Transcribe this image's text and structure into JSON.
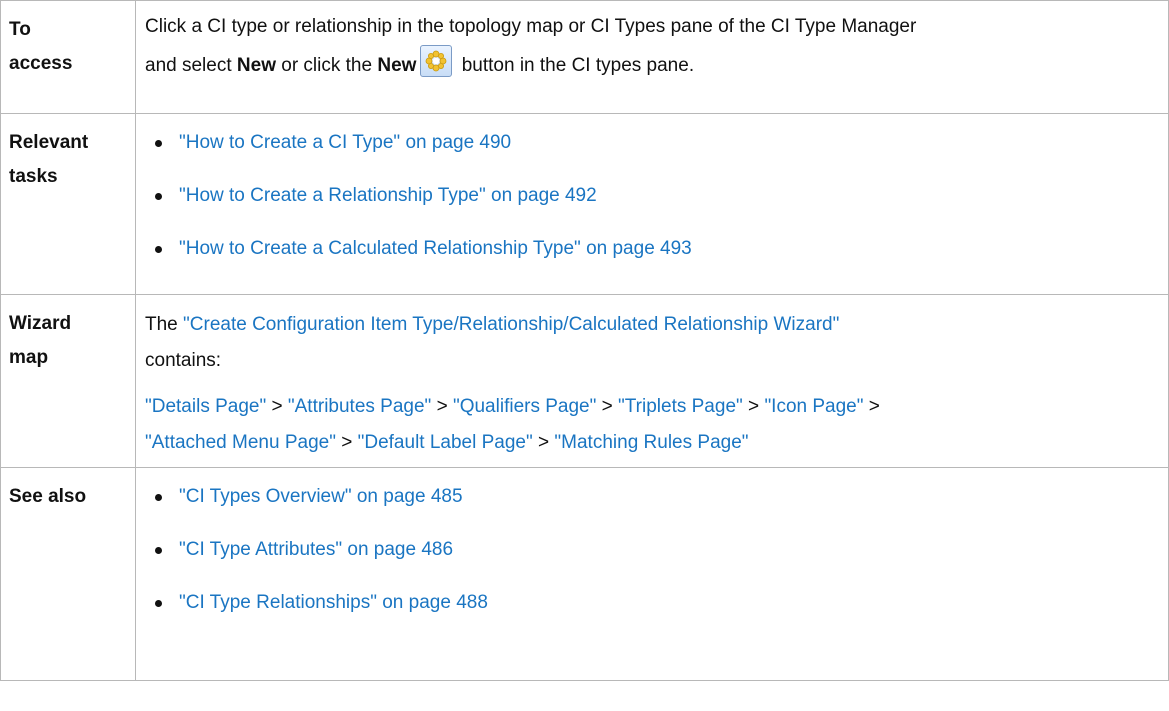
{
  "rows": {
    "access": {
      "label_line1": "To",
      "label_line2": "access",
      "text1": "Click a CI type or relationship in the topology map or CI Types pane of the CI Type Manager",
      "text2": "and select ",
      "bold_new1": "New",
      "text3": " or click the ",
      "bold_new2": "New",
      "text4": " button in the CI types pane.",
      "icon": "new-icon"
    },
    "tasks": {
      "label_line1": "Relevant",
      "label_line2": "tasks",
      "items": [
        "\"How to Create a CI Type\" on page 490",
        "\"How to Create a Relationship Type\" on page 492",
        "\"How to Create a Calculated Relationship Type\" on page 493"
      ]
    },
    "wizard": {
      "label_line1": "Wizard",
      "label_line2": "map",
      "intro_prefix": "The ",
      "wizard_link": "\"Create Configuration Item Type/Relationship/Calculated Relationship Wizard\"",
      "intro_suffix": "contains:",
      "separator": ">",
      "pages": [
        "\"Details Page\"",
        "\"Attributes Page\"",
        "\"Qualifiers Page\"",
        "\"Triplets Page\"",
        "\"Icon Page\"",
        "\"Attached Menu Page\"",
        "\"Default Label Page\"",
        "\"Matching Rules Page\""
      ]
    },
    "see_also": {
      "label": "See also",
      "items": [
        "\"CI Types Overview\" on page 485",
        "\"CI Type Attributes\" on page 486",
        "\"CI Type Relationships\" on page 488"
      ]
    }
  },
  "colors": {
    "link": "#1a75c2",
    "border": "#b8b8b8",
    "text": "#111111"
  }
}
